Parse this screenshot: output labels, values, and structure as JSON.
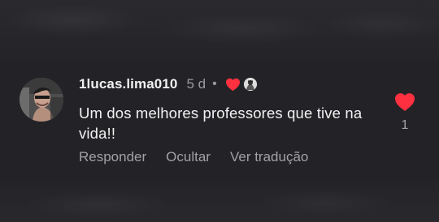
{
  "comment": {
    "username": "1lucas.lima010",
    "time": "5 d",
    "separator": "•",
    "text": "Um dos melhores professores que tive na vida!!",
    "actions": {
      "reply": "Responder",
      "hide": "Ocultar",
      "translate": "Ver tradução"
    },
    "likes": "1"
  },
  "colors": {
    "background": "#232327",
    "primary_text": "#f2f2f2",
    "secondary_text": "#9a9aa0",
    "heart": "#ff3040"
  },
  "icons": {
    "author_like": "heart-icon",
    "like": "heart-icon"
  }
}
